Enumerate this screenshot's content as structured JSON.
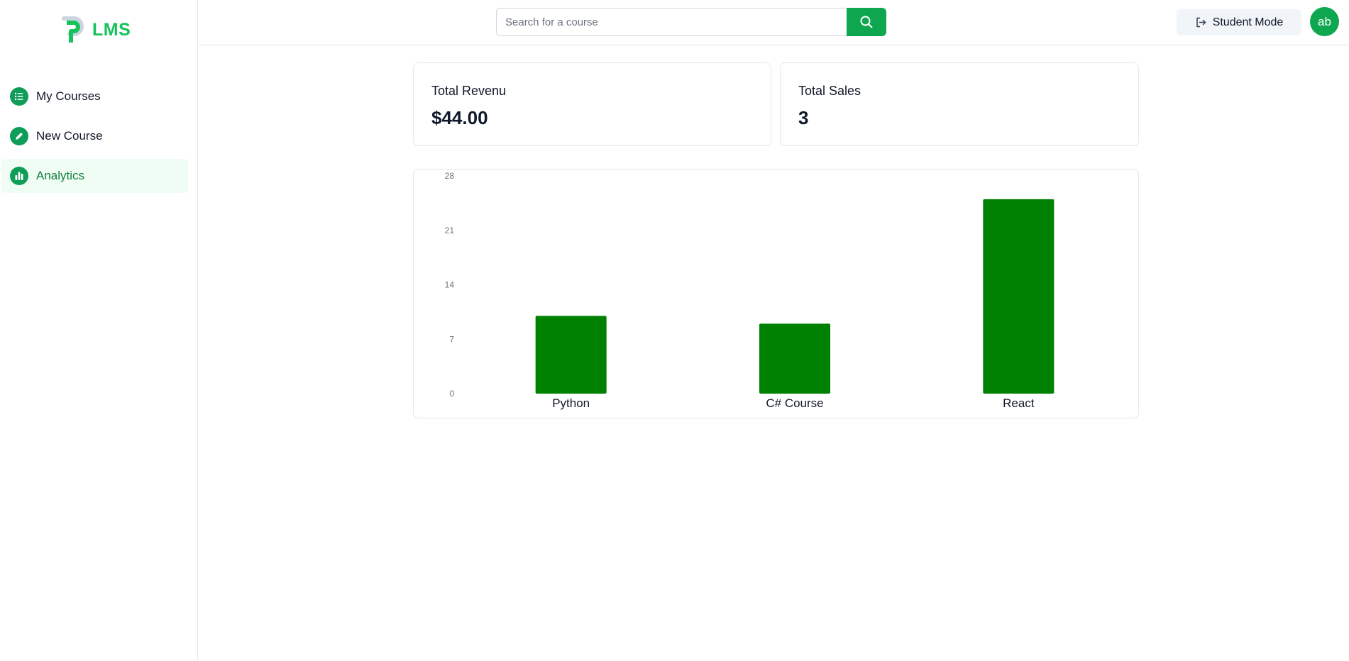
{
  "app": {
    "logo_text": "LMS",
    "brand_color": "#16c25a"
  },
  "sidebar": {
    "items": [
      {
        "label": "My Courses",
        "icon": "list-icon",
        "active": false
      },
      {
        "label": "New Course",
        "icon": "pencil-icon",
        "active": false
      },
      {
        "label": "Analytics",
        "icon": "bar-chart-icon",
        "active": true
      }
    ]
  },
  "header": {
    "search": {
      "placeholder": "Search for a course",
      "value": ""
    },
    "student_mode_label": "Student Mode",
    "avatar_initials": "ab"
  },
  "stats": {
    "revenue": {
      "title": "Total Revenu",
      "value": "$44.00"
    },
    "sales": {
      "title": "Total Sales",
      "value": "3"
    }
  },
  "chart_data": {
    "type": "bar",
    "categories": [
      "Python",
      "C# Course",
      "React"
    ],
    "values": [
      10,
      9,
      25
    ],
    "ylim": [
      0,
      28
    ],
    "yticks": [
      0,
      7,
      14,
      21,
      28
    ],
    "bar_color": "#008000",
    "grid": false,
    "title": "",
    "xlabel": "",
    "ylabel": ""
  }
}
